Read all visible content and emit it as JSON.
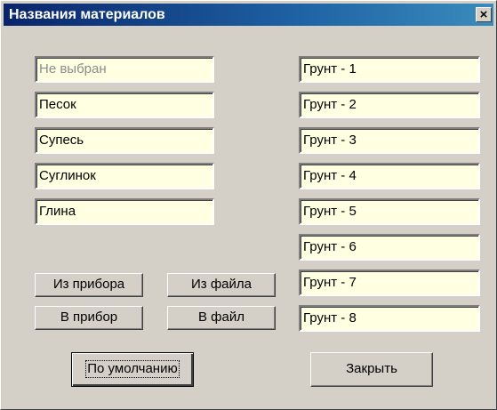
{
  "window": {
    "title": "Названия материалов",
    "close_label": "×"
  },
  "materials_left": [
    {
      "value": "Не выбран",
      "placeholder": true
    },
    {
      "value": "Песок"
    },
    {
      "value": "Супесь"
    },
    {
      "value": "Суглинок"
    },
    {
      "value": "Глина"
    }
  ],
  "materials_right": [
    {
      "value": "Грунт - 1"
    },
    {
      "value": "Грунт - 2"
    },
    {
      "value": "Грунт - 3"
    },
    {
      "value": "Грунт - 4"
    },
    {
      "value": "Грунт - 5"
    },
    {
      "value": "Грунт - 6"
    },
    {
      "value": "Грунт - 7"
    },
    {
      "value": "Грунт - 8"
    }
  ],
  "buttons": {
    "from_device": "Из прибора",
    "from_file": "Из файла",
    "to_device": "В прибор",
    "to_file": "В файл",
    "defaults": "По умолчанию",
    "close": "Закрыть"
  },
  "colors": {
    "field_background": "#ffffe1",
    "dialog_face": "#d4d0c8",
    "title_gradient_start": "#0a246a",
    "title_gradient_end": "#3a8cbc"
  }
}
